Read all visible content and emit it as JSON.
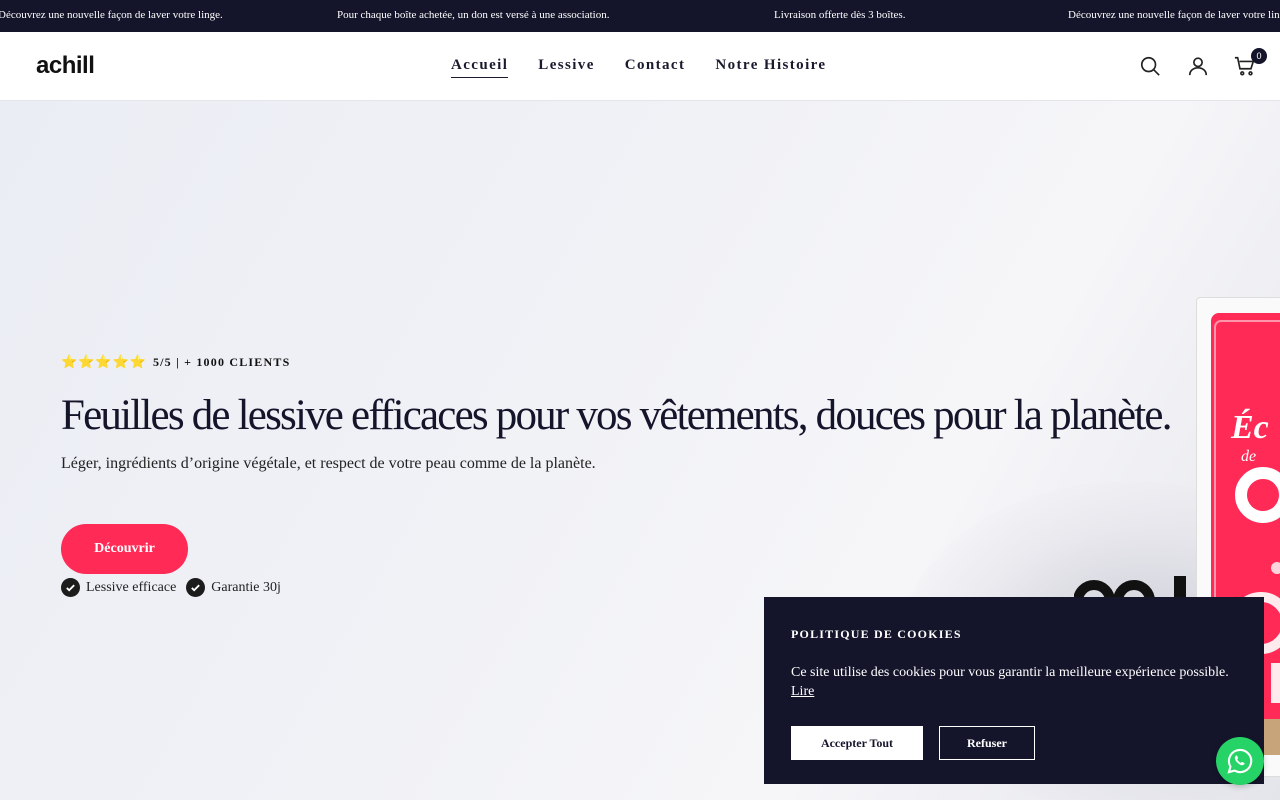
{
  "announcement": {
    "items": [
      "Découvrez une nouvelle façon de laver votre linge.",
      "Pour chaque boîte achetée, un don est versé à une association.",
      "Livraison offerte dès 3 boîtes.",
      "Découvrez une nouvelle façon de laver votre linge."
    ]
  },
  "header": {
    "logo": "achill",
    "nav": [
      {
        "label": "Accueil",
        "active": true
      },
      {
        "label": "Lessive",
        "active": false
      },
      {
        "label": "Contact",
        "active": false
      },
      {
        "label": "Notre Histoire",
        "active": false
      }
    ],
    "icons": [
      "search-icon",
      "account-icon",
      "cart-icon"
    ],
    "cart_count": "0"
  },
  "hero": {
    "stars": "⭐⭐⭐⭐⭐",
    "rating": "5/5 | + 1000 CLIENTS",
    "title": "Feuilles de lessive efficaces pour vos vêtements, douces pour la planète.",
    "subtitle": "Léger, ingrédients d’origine végétale, et respect de votre peau comme de la planète.",
    "cta": "Découvrir",
    "badges": [
      "Lessive efficace",
      "Garantie 30j"
    ],
    "accent_color": "#ff2a55"
  },
  "cookie": {
    "title": "POLITIQUE DE COOKIES",
    "body": "Ce site utilise des cookies pour vous garantir la meilleure expérience possible.",
    "link": "Lire",
    "accept": "Accepter Tout",
    "refuse": "Refuser"
  },
  "whatsapp": {
    "icon": "whatsapp-icon",
    "color": "#25d366"
  }
}
